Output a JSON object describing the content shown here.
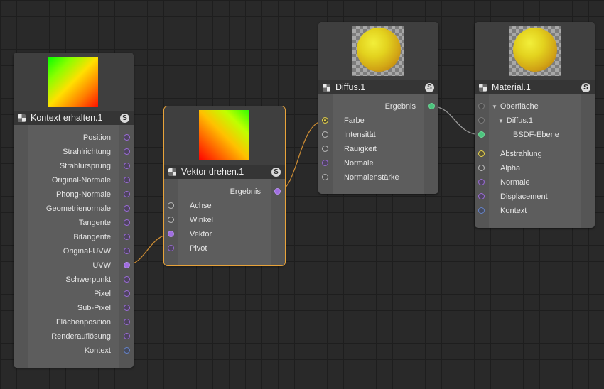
{
  "nodes": {
    "context": {
      "title": "Kontext erhalten.1",
      "badge": "S",
      "outputs": [
        "Position",
        "Strahlrichtung",
        "Strahlursprung",
        "Original-Normale",
        "Phong-Normale",
        "Geometrienormale",
        "Tangente",
        "Bitangente",
        "Original-UVW",
        "UVW",
        "Schwerpunkt",
        "Pixel",
        "Sub-Pixel",
        "Flächenposition",
        "Renderauflösung",
        "Kontext"
      ]
    },
    "rotate": {
      "title": "Vektor drehen.1",
      "badge": "S",
      "output": "Ergebnis",
      "inputs": [
        "Achse",
        "Winkel",
        "Vektor",
        "Pivot"
      ]
    },
    "diffuse": {
      "title": "Diffus.1",
      "badge": "S",
      "output": "Ergebnis",
      "inputs": [
        "Farbe",
        "Intensität",
        "Rauigkeit",
        "Normale",
        "Normalenstärke"
      ]
    },
    "material": {
      "title": "Material.1",
      "badge": "S",
      "tree": [
        "Oberfläche",
        "Diffus.1",
        "BSDF-Ebene"
      ],
      "inputs": [
        "Abstrahlung",
        "Alpha",
        "Normale",
        "Displacement",
        "Kontext"
      ]
    }
  },
  "colors": {
    "wire": "#e8a33a",
    "wire_grey": "#9a9a9a",
    "selected_border": "#e8a33a",
    "port_purple": "#a06ee0",
    "port_green": "#4cc47e"
  }
}
